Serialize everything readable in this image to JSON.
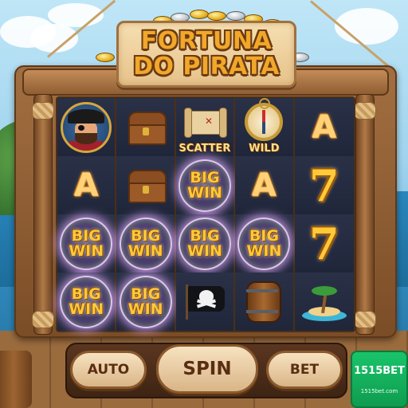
{
  "title": {
    "line1": "FORTUNA",
    "line2": "DO PIRATA"
  },
  "reels": {
    "rows": [
      [
        {
          "type": "pirate",
          "icon": "pirate-captain-icon",
          "label": ""
        },
        {
          "type": "chest",
          "icon": "treasure-chest-icon",
          "label": ""
        },
        {
          "type": "scatter",
          "icon": "treasure-map-icon",
          "label": "SCATTER"
        },
        {
          "type": "wild",
          "icon": "compass-icon",
          "label": "WILD"
        },
        {
          "type": "letter",
          "icon": "letter-a-icon",
          "label": "A"
        }
      ],
      [
        {
          "type": "letter",
          "icon": "letter-a-icon",
          "label": "A"
        },
        {
          "type": "chest",
          "icon": "treasure-chest-icon",
          "label": ""
        },
        {
          "type": "bigwin",
          "icon": "big-win-badge",
          "label1": "BIG",
          "label2": "WIN"
        },
        {
          "type": "letter",
          "icon": "letter-a-icon",
          "label": "A"
        },
        {
          "type": "seven",
          "icon": "seven-icon",
          "label": "7"
        }
      ],
      [
        {
          "type": "bigwin",
          "icon": "big-win-badge",
          "label1": "BIG",
          "label2": "WIN"
        },
        {
          "type": "bigwin",
          "icon": "big-win-badge",
          "label1": "BIG",
          "label2": "WIN"
        },
        {
          "type": "bigwin",
          "icon": "big-win-badge",
          "label1": "BIG",
          "label2": "WIN"
        },
        {
          "type": "bigwin",
          "icon": "big-win-badge",
          "label1": "BIG",
          "label2": "WIN"
        },
        {
          "type": "seven",
          "icon": "seven-icon",
          "label": "7"
        }
      ],
      [
        {
          "type": "bigwin",
          "icon": "big-win-badge",
          "label1": "BIG",
          "label2": "WIN"
        },
        {
          "type": "bigwin",
          "icon": "big-win-badge",
          "label1": "BIG",
          "label2": "WIN"
        },
        {
          "type": "flag",
          "icon": "jolly-roger-flag-icon",
          "label": ""
        },
        {
          "type": "barrel",
          "icon": "barrel-icon",
          "label": ""
        },
        {
          "type": "island",
          "icon": "palm-island-icon",
          "label": ""
        }
      ]
    ]
  },
  "controls": {
    "auto_label": "AUTO",
    "spin_label": "SPIN",
    "bet_label": "BET"
  },
  "brand": {
    "name": "1515BET",
    "url": "1515bet.com"
  },
  "colors": {
    "brand_green": "#19c46a",
    "title_gold": "#f1a72a",
    "button_cream": "#f7e2c0",
    "wood": "#8f5e33"
  }
}
